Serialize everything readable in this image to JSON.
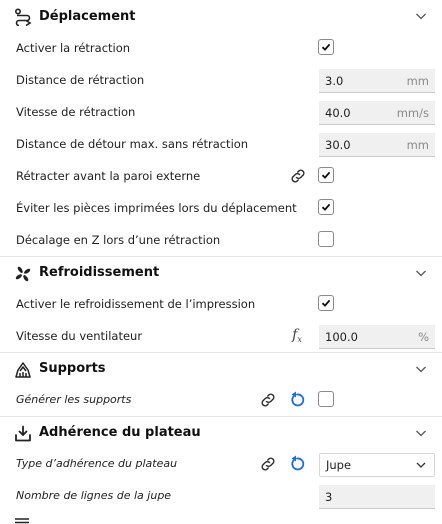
{
  "colors": {
    "accent": "#196ef0",
    "icon": "#222222",
    "chevron": "#555555",
    "field_bg": "#f0f0f0"
  },
  "sections": {
    "travel": {
      "icon": "travel-icon",
      "title": "Déplacement",
      "retraction_enable": {
        "label": "Activer la rétraction",
        "checked": true
      },
      "retraction_distance": {
        "label": "Distance de rétraction",
        "value": "3.0",
        "unit": "mm"
      },
      "retraction_speed": {
        "label": "Vitesse de rétraction",
        "value": "40.0",
        "unit": "mm/s"
      },
      "max_comb_distance": {
        "label": "Distance de détour max. sans rétraction",
        "value": "30.0",
        "unit": "mm"
      },
      "retract_before_outer_wall": {
        "label": "Rétracter avant la paroi externe",
        "checked": true
      },
      "avoid_printed_parts": {
        "label": "Éviter les pièces imprimées lors du déplacement",
        "checked": true
      },
      "z_hop": {
        "label": "Décalage en Z lors d’une rétraction",
        "checked": false
      }
    },
    "cooling": {
      "icon": "fan-icon",
      "title": "Refroidissement",
      "fan_enabled": {
        "label": "Activer le refroidissement de l’impression",
        "checked": true
      },
      "fan_speed": {
        "label": "Vitesse du ventilateur",
        "value": "100.0",
        "unit": "%"
      }
    },
    "support": {
      "icon": "support-icon",
      "title": "Supports",
      "support_enable": {
        "label": "Générer les supports",
        "checked": false
      }
    },
    "adhesion": {
      "icon": "adhesion-icon",
      "title": "Adhérence du plateau",
      "adhesion_type": {
        "label": "Type d’adhérence du plateau",
        "value": "Jupe"
      },
      "skirt_lines": {
        "label": "Nombre de lignes de la jupe",
        "value": "3"
      }
    }
  }
}
